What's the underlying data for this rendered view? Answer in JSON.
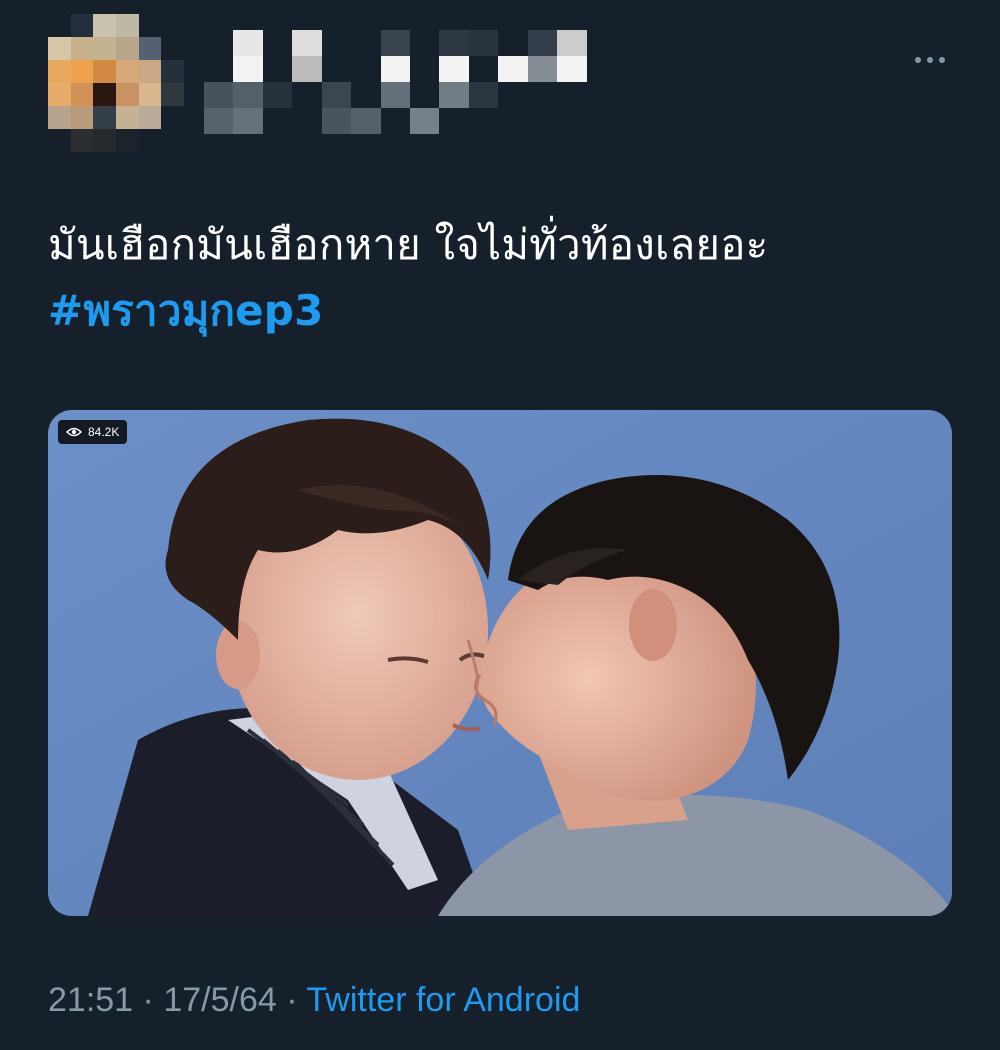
{
  "header": {
    "more_icon": "more-horizontal-icon"
  },
  "tweet": {
    "text_line1": "มันเฮือกมันเฮือกหาย ใจไม่ทั่วท้องเลยอะ",
    "hashtag": "#พราวมุกep3"
  },
  "media": {
    "view_count": "84.2K",
    "view_icon": "eye-icon"
  },
  "meta": {
    "time": "21:51",
    "date": "17/5/64",
    "separator": "·",
    "source": "Twitter for Android"
  },
  "colors": {
    "background": "#15202b",
    "text": "#ffffff",
    "secondary": "#8899a6",
    "link": "#1d9bf0"
  }
}
